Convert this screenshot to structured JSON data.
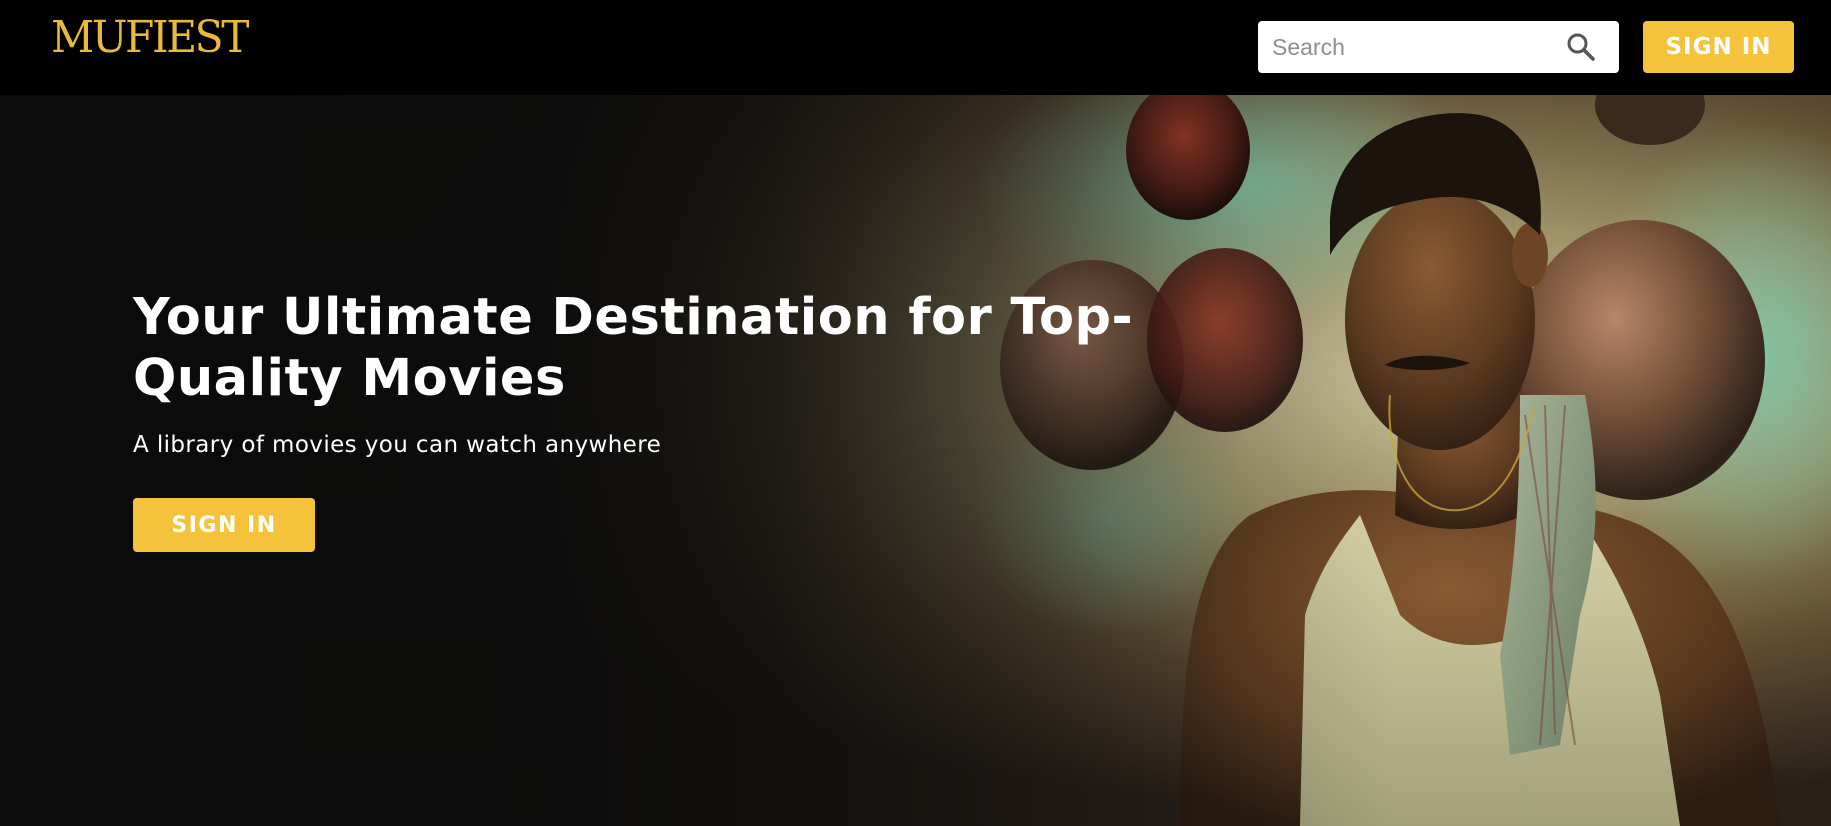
{
  "header": {
    "logo": "MUFIEST",
    "search": {
      "placeholder": "Search",
      "value": ""
    },
    "signin_label": "SIGN IN"
  },
  "hero": {
    "title": "Your Ultimate Destination for Top-Quality Movies",
    "subtitle": "A library of movies you can watch anywhere",
    "signin_label": "SIGN IN"
  },
  "icons": {
    "search": "search-icon"
  },
  "colors": {
    "accent": "#f5c33b",
    "logo": "#e9b93a",
    "header_bg": "#000000",
    "hero_bg": "#0b0b0b",
    "text": "#ffffff"
  }
}
